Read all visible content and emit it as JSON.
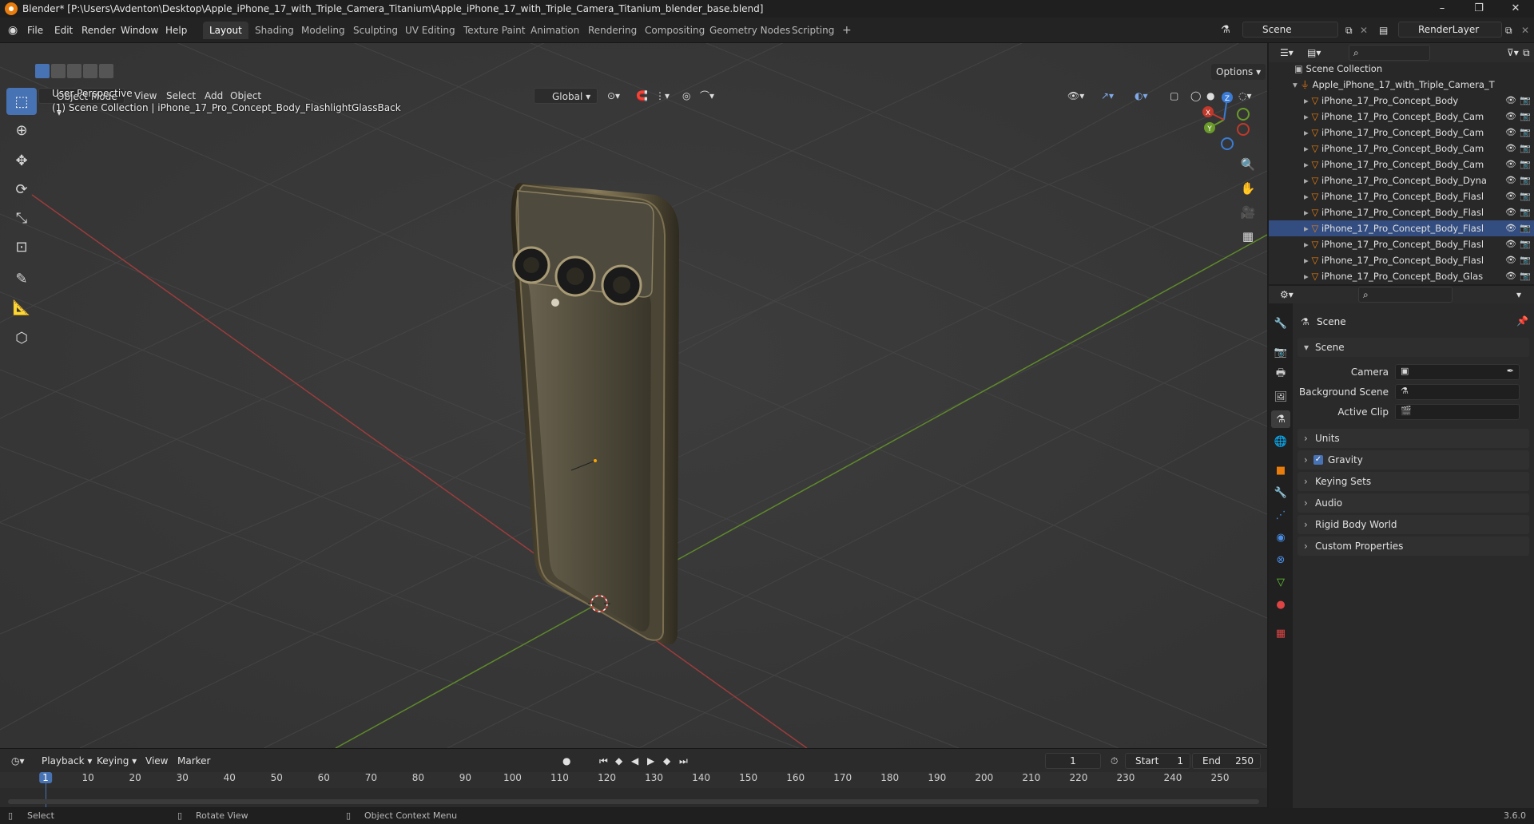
{
  "window": {
    "title": "Blender* [P:\\Users\\Avdenton\\Desktop\\Apple_iPhone_17_with_Triple_Camera_Titanium\\Apple_iPhone_17_with_Triple_Camera_Titanium_blender_base.blend]",
    "controls": [
      "–",
      "❐",
      "✕"
    ]
  },
  "menu": {
    "items": [
      "File",
      "Edit",
      "Render",
      "Window",
      "Help"
    ],
    "workspaces": [
      "Layout",
      "Shading",
      "Modeling",
      "Sculpting",
      "UV Editing",
      "Texture Paint",
      "Animation",
      "Rendering",
      "Compositing",
      "Geometry Nodes",
      "Scripting"
    ],
    "active_workspace": "Layout",
    "add_tab": "+",
    "scene": "Scene",
    "view_layer": "RenderLayer"
  },
  "viewport": {
    "mode": "Object Mode",
    "menus": [
      "View",
      "Select",
      "Add",
      "Object"
    ],
    "orientation": "Global",
    "options": "Options",
    "perspective": "User Perspective",
    "collection_info": "(1) Scene Collection | iPhone_17_Pro_Concept_Body_FlashlightGlassBack",
    "gizmo_axes": [
      "Z",
      "Y",
      "X"
    ]
  },
  "timeline": {
    "menus": [
      "Playback",
      "Keying",
      "View",
      "Marker"
    ],
    "current_frame": "1",
    "start_label": "Start",
    "start_value": "1",
    "end_label": "End",
    "end_value": "250",
    "ticks": [
      "1",
      "10",
      "20",
      "30",
      "40",
      "50",
      "60",
      "70",
      "80",
      "90",
      "100",
      "110",
      "120",
      "130",
      "140",
      "150",
      "160",
      "170",
      "180",
      "190",
      "200",
      "210",
      "220",
      "230",
      "240",
      "250"
    ]
  },
  "statusbar": {
    "items": [
      "Select",
      "Rotate View",
      "Object Context Menu"
    ],
    "version": "3.6.0"
  },
  "outliner": {
    "root": "Scene Collection",
    "collection": "Apple_iPhone_17_with_Triple_Camera_T",
    "objects": [
      "iPhone_17_Pro_Concept_Body",
      "iPhone_17_Pro_Concept_Body_Cam",
      "iPhone_17_Pro_Concept_Body_Cam",
      "iPhone_17_Pro_Concept_Body_Cam",
      "iPhone_17_Pro_Concept_Body_Cam",
      "iPhone_17_Pro_Concept_Body_Dyna",
      "iPhone_17_Pro_Concept_Body_Flasl",
      "iPhone_17_Pro_Concept_Body_Flasl",
      "iPhone_17_Pro_Concept_Body_Flasl",
      "iPhone_17_Pro_Concept_Body_Flasl",
      "iPhone_17_Pro_Concept_Body_Flasl",
      "iPhone_17_Pro_Concept_Body_Glas"
    ],
    "selected_index": 8
  },
  "properties": {
    "header": "Scene",
    "section": "Scene",
    "fields": [
      {
        "label": "Camera"
      },
      {
        "label": "Background Scene"
      },
      {
        "label": "Active Clip"
      }
    ],
    "panels": [
      "Units",
      "Gravity",
      "Keying Sets",
      "Audio",
      "Rigid Body World",
      "Custom Properties"
    ],
    "gravity_checked": true
  },
  "colors": {
    "accent": "#4772b3",
    "x_axis": "#c0392b",
    "y_axis": "#6a9a2a",
    "z_axis": "#3a7bd5",
    "object_orange": "#e87d0d"
  }
}
